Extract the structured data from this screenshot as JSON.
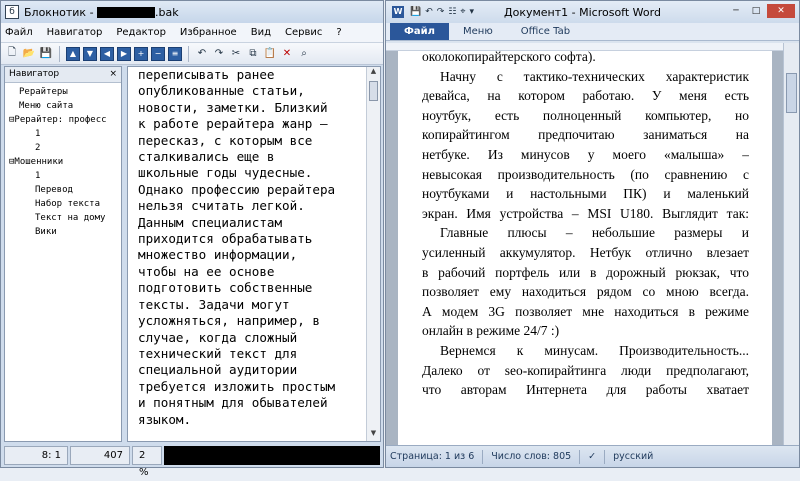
{
  "notepad": {
    "title_prefix": "Блокнотик - ",
    "title_suffix": ".bak",
    "menu": [
      "Файл",
      "Навигатор",
      "Редактор",
      "Избранное",
      "Вид",
      "Сервис",
      "?"
    ],
    "navigator": {
      "header": "Навигатор",
      "close": "×",
      "items": [
        {
          "label": "Рерайтеры",
          "level": 0
        },
        {
          "label": "Меню сайта",
          "level": 0
        },
        {
          "label": "Рерайтер: професс",
          "level": 0,
          "toggle": "⊟"
        },
        {
          "label": "1",
          "level": 1
        },
        {
          "label": "2",
          "level": 1
        },
        {
          "label": "Мошенники",
          "level": 0,
          "toggle": "⊟"
        },
        {
          "label": "1",
          "level": 1
        },
        {
          "label": "Перевод",
          "level": 1
        },
        {
          "label": "Набор текста",
          "level": 1
        },
        {
          "label": "Текст на дому",
          "level": 1
        },
        {
          "label": "Вики",
          "level": 1
        }
      ]
    },
    "editor_lines": [
      "переписывать ранее",
      "опубликованные статьи,",
      "новости, заметки. Близкий",
      "к работе рерайтера жанр –",
      "пересказ, с которым все",
      "сталкивались еще в",
      "школьные годы чудесные.",
      "Однако профессию рерайтера",
      "нельзя считать легкой.",
      "Данным специалистам",
      "приходится обрабатывать",
      "множество информации,",
      "чтобы на ее основе",
      "подготовить собственные",
      "тексты. Задачи могут",
      "усложняться, например, в",
      "случае, когда сложный",
      "технический текст для",
      "специальной аудитории",
      "требуется изложить простым",
      "и понятным для обывателей",
      "языком."
    ],
    "status": {
      "position": "8:  1",
      "count": "407",
      "percent": "2 %"
    }
  },
  "word": {
    "title": "Документ1 - Microsoft Word",
    "tabs": [
      "Файл",
      "Меню",
      "Office Tab"
    ],
    "lines": [
      {
        "text": "околокопирайтерского софта).",
        "cls": ""
      },
      {
        "text": "Начну с тактико-технических характеристик",
        "cls": "ind just"
      },
      {
        "text": "девайса, на котором работаю. У меня есть",
        "cls": "just"
      },
      {
        "text": "ноутбук, есть полноценный компьютер, но",
        "cls": "just"
      },
      {
        "text": "копирайтингом предпочитаю заниматься на",
        "cls": "just"
      },
      {
        "text": "нетбуке. Из минусов у моего «малыша» –",
        "cls": "just"
      },
      {
        "text": "невысокая производительность (по сравнению с",
        "cls": "just"
      },
      {
        "text": "ноутбуками и настольными ПК) и маленький",
        "cls": "just"
      },
      {
        "text": "экран. Имя устройства – MSI U180. Выглядит так:",
        "cls": "just"
      },
      {
        "text": "Главные плюсы – небольшие размеры и",
        "cls": "ind just"
      },
      {
        "text": "усиленный аккумулятор. Нетбук отлично влезает",
        "cls": "just"
      },
      {
        "text": "в рабочий портфель или в дорожный рюкзак, что",
        "cls": "just"
      },
      {
        "text": "позволяет ему находиться рядом со мною всегда.",
        "cls": "just"
      },
      {
        "text": "А модем 3G позволяет мне находиться в режиме",
        "cls": "just"
      },
      {
        "text": "онлайн в режиме 24/7 :)",
        "cls": ""
      },
      {
        "text": "Вернемся к минусам. Производительность...",
        "cls": "ind just"
      },
      {
        "text": "Далеко от seo-копирайтинга люди предполагают,",
        "cls": "just"
      },
      {
        "text": "что авторам Интернета для работы хватает",
        "cls": "just"
      }
    ],
    "status": {
      "page": "Страница: 1 из 6",
      "words": "Число слов: 805",
      "lang": "русский"
    }
  }
}
